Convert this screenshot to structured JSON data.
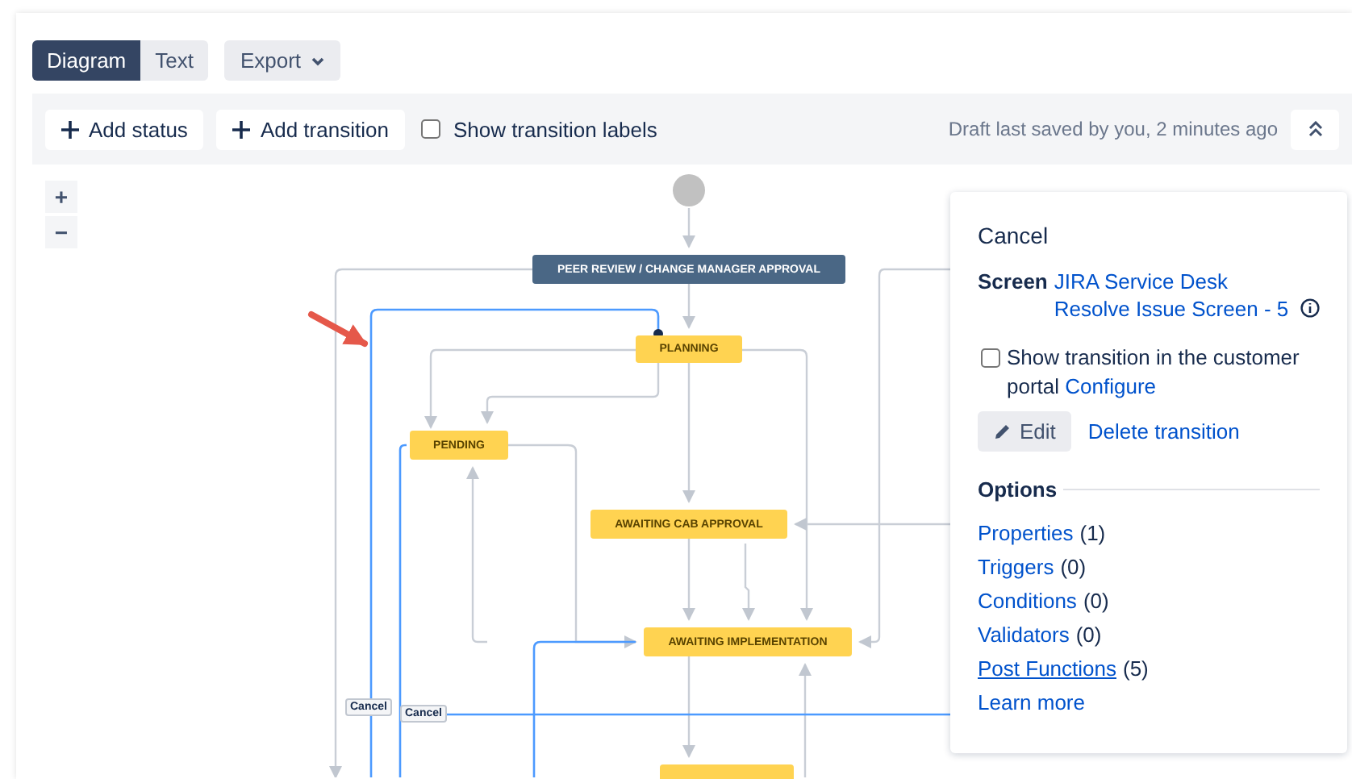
{
  "view_tabs": [
    {
      "label": "Diagram",
      "selected": true
    },
    {
      "label": "Text",
      "selected": false
    }
  ],
  "export_button": {
    "label": "Export"
  },
  "toolbar": {
    "add_status": "Add status",
    "add_transition": "Add transition",
    "show_labels": {
      "label": "Show transition labels",
      "checked": false
    },
    "draft_note": "Draft last saved by you, 2 minutes ago"
  },
  "zoom": {
    "in": "+",
    "out": "−"
  },
  "statuses": [
    {
      "label": "PEER REVIEW / CHANGE MANAGER APPROVAL",
      "color": "#4a6785"
    },
    {
      "label": "PLANNING",
      "color": "#ffd351"
    },
    {
      "label": "PENDING",
      "color": "#ffd351"
    },
    {
      "label": "AWAITING CAB APPROVAL",
      "color": "#ffd351"
    },
    {
      "label": "AWAITING IMPLEMENTATION",
      "color": "#ffd351"
    },
    {
      "color": "#ffd351"
    }
  ],
  "transition_labels": [
    "Cancel",
    "Cancel"
  ],
  "panel": {
    "title": "Cancel",
    "screen_label": "Screen",
    "screen_link": "JIRA Service Desk Resolve Issue Screen - 5",
    "portal_checkbox": {
      "label": "Show transition in the customer portal",
      "checked": false
    },
    "configure_link": "Configure",
    "edit_button": "Edit",
    "delete_link": "Delete transition",
    "options_heading": "Options",
    "options": [
      {
        "label": "Properties",
        "count": "(1)",
        "hovered": false
      },
      {
        "label": "Triggers",
        "count": "(0)",
        "hovered": false
      },
      {
        "label": "Conditions",
        "count": "(0)",
        "hovered": false
      },
      {
        "label": "Validators",
        "count": "(0)",
        "hovered": false
      },
      {
        "label": "Post Functions",
        "count": "(5)",
        "hovered": true
      }
    ],
    "learn_more": "Learn more"
  }
}
